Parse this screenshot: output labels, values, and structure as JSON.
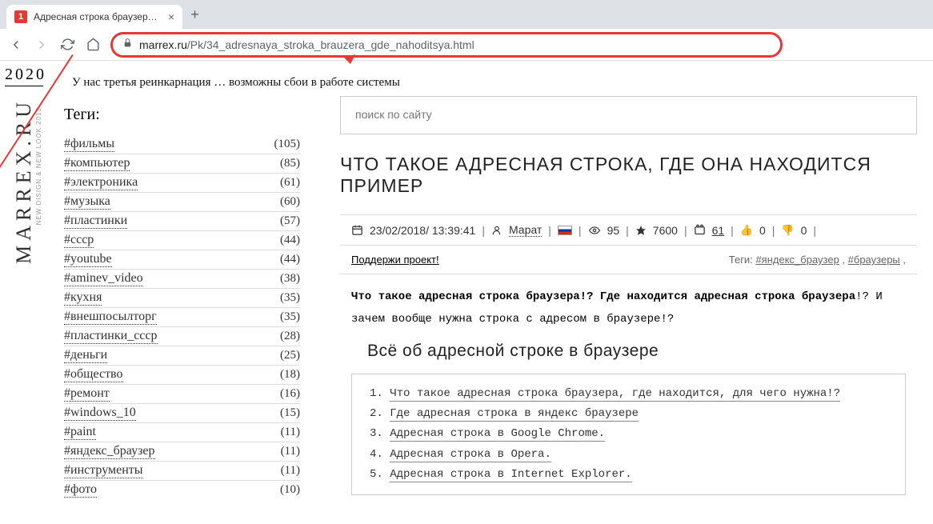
{
  "browser": {
    "tab": {
      "favicon": "1",
      "title": "Адресная строка браузера где"
    },
    "url_domain": "marrex.ru",
    "url_path": "/Pk/34_adresnaya_stroka_brauzera_gde_nahoditsya.html"
  },
  "brand": {
    "year": "2020",
    "name": "MARREX.RU",
    "sub": "NEW DISIGN & NEW LOOK 2013"
  },
  "banner": "У нас третья реинкарнация … возможны сбои в работе системы",
  "tags_title": "Теги:",
  "tags": [
    {
      "name": "#фильмы",
      "count": "(105)"
    },
    {
      "name": "#компьютер",
      "count": "(85)"
    },
    {
      "name": "#электроника",
      "count": "(61)"
    },
    {
      "name": "#музыка",
      "count": "(60)"
    },
    {
      "name": "#пластинки",
      "count": "(57)"
    },
    {
      "name": "#ссср",
      "count": "(44)"
    },
    {
      "name": "#youtube",
      "count": "(44)"
    },
    {
      "name": "#aminev_video",
      "count": "(38)"
    },
    {
      "name": "#кухня",
      "count": "(35)"
    },
    {
      "name": "#внешпосылторг",
      "count": "(35)"
    },
    {
      "name": "#пластинки_ссср",
      "count": "(28)"
    },
    {
      "name": "#деньги",
      "count": "(25)"
    },
    {
      "name": "#общество",
      "count": "(18)"
    },
    {
      "name": "#ремонт",
      "count": "(16)"
    },
    {
      "name": "#windows_10",
      "count": "(15)"
    },
    {
      "name": "#paint",
      "count": "(11)"
    },
    {
      "name": "#яндекс_браузер",
      "count": "(11)"
    },
    {
      "name": "#инструменты",
      "count": "(11)"
    },
    {
      "name": "#фото",
      "count": "(10)"
    }
  ],
  "search_placeholder": "поиск по сайту",
  "page_title": "ЧТО ТАКОЕ АДРЕСНАЯ СТРОКА, ГДЕ ОНА НАХОДИТСЯ ПРИМЕР",
  "meta": {
    "date": "23/02/2018/ 13:39:41",
    "author": "Марат",
    "views": "95",
    "stars": "7600",
    "video": "61",
    "up": "0",
    "down": "0"
  },
  "support": "Поддержи проект!",
  "article_tags_label": "Теги:",
  "article_tags": [
    "#яндекс_браузер",
    "#браузеры"
  ],
  "intro_bold1": "Что такое адресная строка браузера!? Где находится адресная строка браузера",
  "intro_rest": "!? И зачем вообще нужна строка с адресом в браузере!?",
  "subtitle": "Всё об адресной строке в браузере",
  "toc": [
    "Что такое адресная строка браузера, где находится, для чего нужна!?",
    "Где адресная строка в яндекс браузере",
    "Адресная строка в Google Chrome.",
    "Адресная строка в Opera.",
    "Адресная строка в Internet Explorer."
  ]
}
